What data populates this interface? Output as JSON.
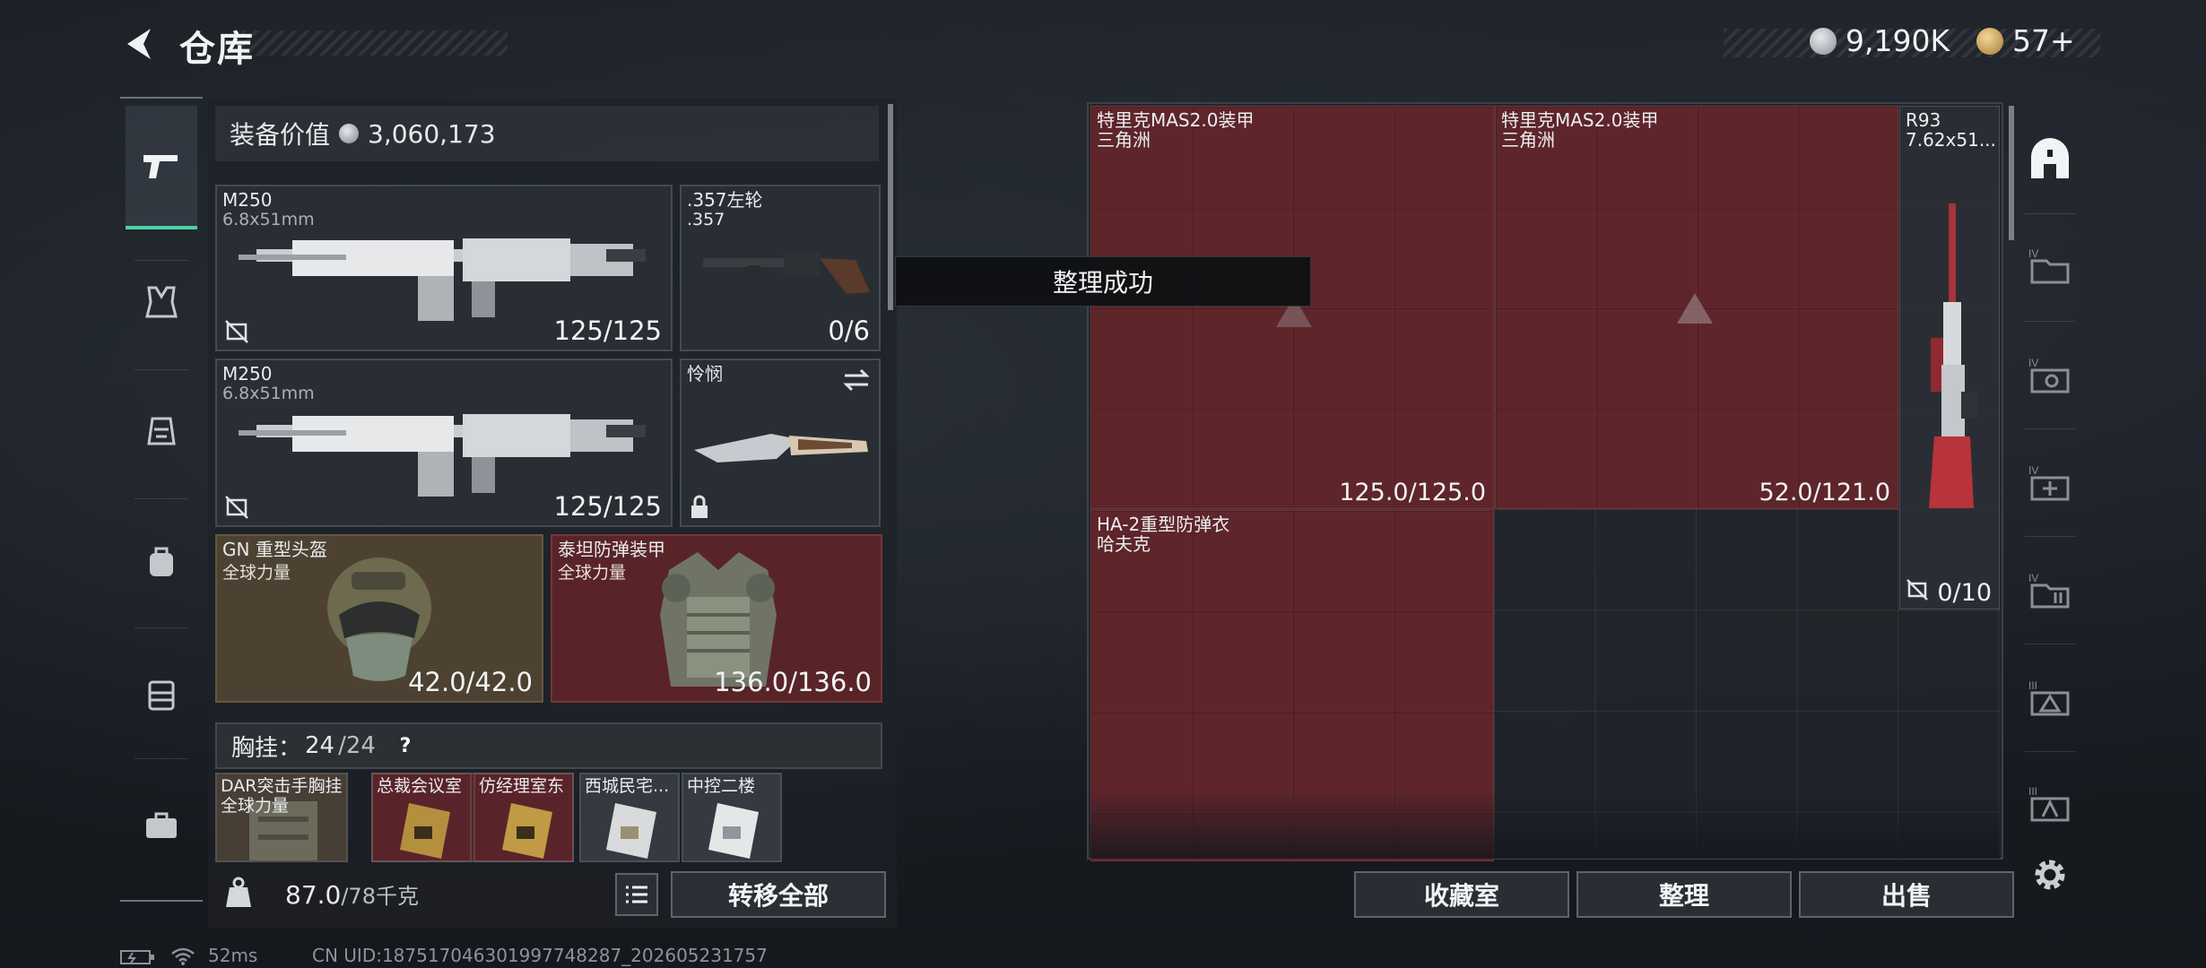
{
  "header": {
    "title": "仓库",
    "currency_silver": "9,190K",
    "currency_gold": "57+"
  },
  "equipment": {
    "label": "装备价值",
    "value": "3,060,173"
  },
  "left_cards": [
    {
      "name": "M250",
      "sub": "6.8x51mm",
      "value": "125/125"
    },
    {
      "name": ".357左轮",
      "sub": ".357",
      "value": "0/6"
    },
    {
      "name": "M250",
      "sub": "6.8x51mm",
      "value": "125/125"
    },
    {
      "name": "怜悯",
      "sub": "",
      "value": ""
    },
    {
      "name": "GN 重型头盔",
      "sub": "全球力量",
      "value": "42.0/42.0"
    },
    {
      "name": "泰坦防弹装甲",
      "sub": "全球力量",
      "value": "136.0/136.0"
    }
  ],
  "chest_rig": {
    "label": "胸挂：",
    "current": "24",
    "max": "/24",
    "help": "?"
  },
  "mini_items": [
    {
      "name": "DAR突击手胸挂",
      "sub": "全球力量"
    },
    {
      "name": "总裁会议室"
    },
    {
      "name": "仿经理室东"
    },
    {
      "name": "西城民宅..."
    },
    {
      "name": "中控二楼"
    }
  ],
  "weight": {
    "current": "87.0",
    "max": "/78千克"
  },
  "transfer_all": "转移全部",
  "toast": "整理成功",
  "storage_items": [
    {
      "name": "特里克MAS2.0装甲",
      "sub": "三角洲",
      "value": "125.0/125.0"
    },
    {
      "name": "特里克MAS2.0装甲",
      "sub": "三角洲",
      "value": "52.0/121.0"
    },
    {
      "name": "R93",
      "sub": "7.62x51...",
      "value": "0/10"
    },
    {
      "name": "HA-2重型防弹衣",
      "sub": "哈夫克",
      "value": ""
    }
  ],
  "actions": {
    "collection": "收藏室",
    "sort": "整理",
    "sell": "出售"
  },
  "status": {
    "ping": "52ms",
    "uid": "CN UID:187517046301997748287_202605231757"
  },
  "colors": {
    "accent": "#4fd1a3",
    "slot_red": "#6e262c",
    "panel": "#22262c"
  }
}
